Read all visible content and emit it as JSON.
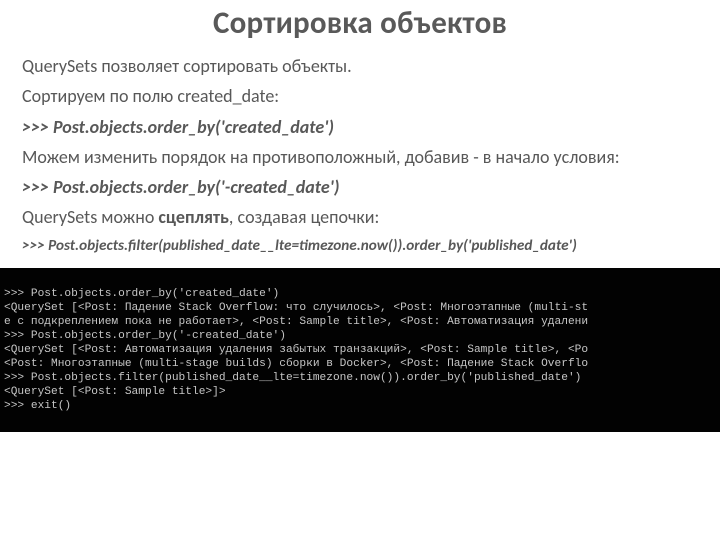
{
  "title": "Сортировка объектов",
  "body": {
    "line1_a": "QuerySets ",
    "line1_b": "позволяет сортировать объекты.",
    "line2": "Сортируем по полю created_date:",
    "code1": ">>> Post.objects.order_by('created_date')",
    "line3": "Можем изменить порядок на противоположный, добавив - в начало условия:",
    "code2": ">>> Post.objects.order_by('-created_date')",
    "line4_a": "QuerySets можно ",
    "line4_bold": "сцеплять",
    "line4_b": ", создавая цепочки:",
    "code3": ">>> Post.objects.filter(published_date__lte=timezone.now()).order_by('published_date')"
  },
  "terminal": {
    "lines": [
      ">>> Post.objects.order_by('created_date')",
      "<QuerySet [<Post: Падение Stack Overflow: что случилось>, <Post: Многоэтапные (multi-st",
      "е с подкреплением пока не работает>, <Post: Sample title>, <Post: Автоматизация удалени",
      ">>> Post.objects.order_by('-created_date')",
      "<QuerySet [<Post: Автоматизация удаления забытых транзакций>, <Post: Sample title>, <Po",
      "<Post: Многоэтапные (multi-stage builds) сборки в Docker>, <Post: Падение Stack Overflo",
      ">>> Post.objects.filter(published_date__lte=timezone.now()).order_by('published_date')",
      "<QuerySet [<Post: Sample title>]>",
      ">>> exit()"
    ]
  }
}
